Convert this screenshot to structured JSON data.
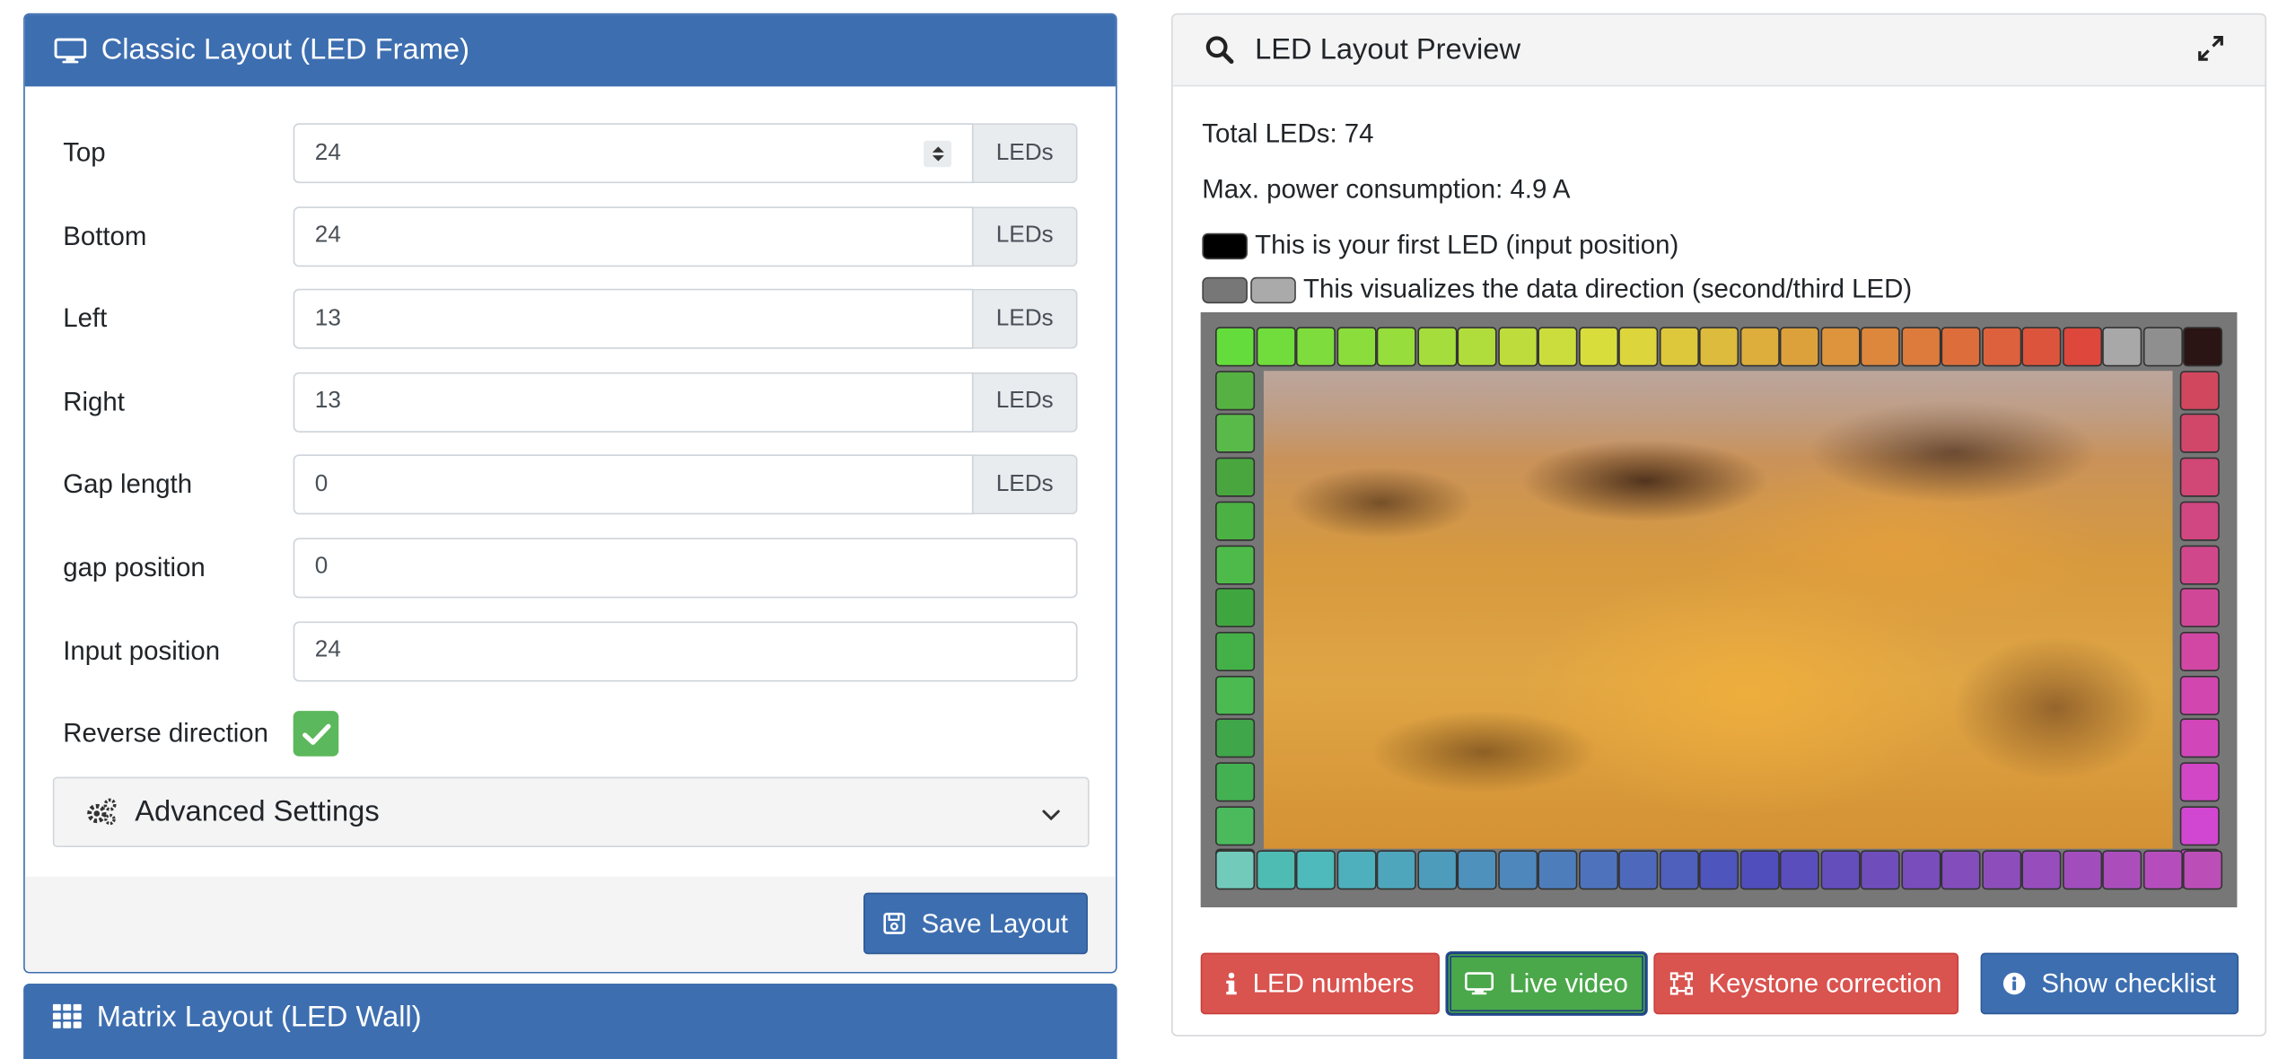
{
  "classic_layout": {
    "title": "Classic Layout (LED Frame)",
    "fields": [
      {
        "label": "Top",
        "value": "24",
        "unit": "LEDs"
      },
      {
        "label": "Bottom",
        "value": "24",
        "unit": "LEDs"
      },
      {
        "label": "Left",
        "value": "13",
        "unit": "LEDs"
      },
      {
        "label": "Right",
        "value": "13",
        "unit": "LEDs"
      },
      {
        "label": "Gap length",
        "value": "0",
        "unit": "LEDs"
      },
      {
        "label": "gap position",
        "value": "0"
      },
      {
        "label": "Input position",
        "value": "24"
      }
    ],
    "reverse_direction_label": "Reverse direction",
    "reverse_direction_checked": true,
    "advanced_settings_label": "Advanced Settings",
    "save_label": "Save Layout"
  },
  "matrix_layout": {
    "title": "Matrix Layout (LED Wall)"
  },
  "preview": {
    "title": "LED Layout Preview",
    "total_leds": "Total LEDs: 74",
    "power": "Max. power consumption: 4.9 A",
    "first_led_text": "This is your first LED (input position)",
    "direction_text": "This visualizes the data direction (second/third LED)",
    "buttons": {
      "led_numbers": "LED numbers",
      "live_video": "Live video",
      "keystone": "Keystone correction",
      "checklist": "Show checklist"
    }
  },
  "colors": {
    "primary": "#3d6eb0",
    "danger": "#d9534f",
    "success": "#4aa84a",
    "checkbox": "#5cb85c"
  },
  "icons": [
    "monitor-icon",
    "grid-icon",
    "search-icon",
    "expand-icon",
    "gears-icon",
    "chevron-down-icon",
    "save-icon",
    "info-icon",
    "keystone-icon",
    "check-icon"
  ]
}
